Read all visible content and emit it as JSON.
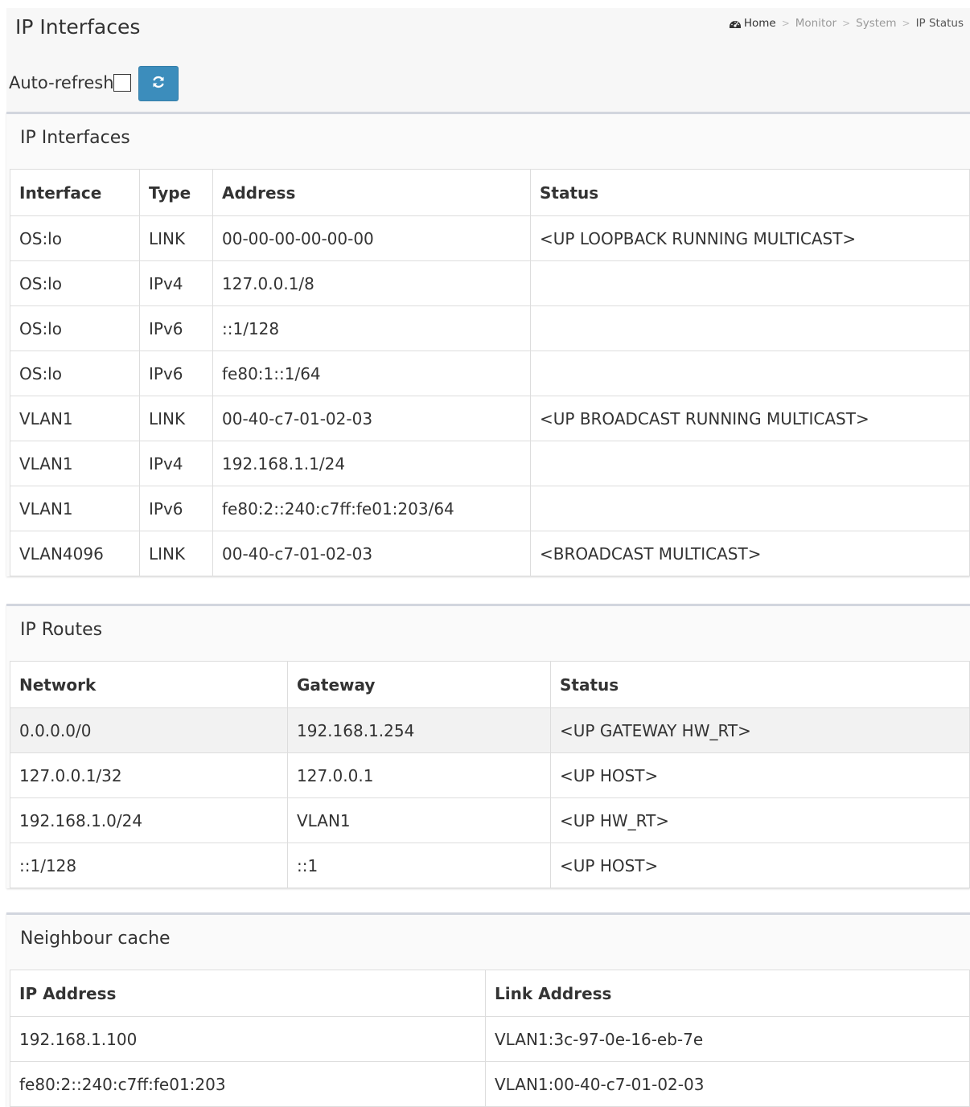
{
  "page": {
    "title": "IP Interfaces",
    "breadcrumb": [
      "Home",
      "Monitor",
      "System",
      "IP Status"
    ]
  },
  "toolbar": {
    "auto_refresh_label": "Auto-refresh",
    "auto_refresh_checked": false
  },
  "ip_interfaces": {
    "title": "IP Interfaces",
    "headers": [
      "Interface",
      "Type",
      "Address",
      "Status"
    ],
    "rows": [
      [
        "OS:lo",
        "LINK",
        "00-00-00-00-00-00",
        "<UP LOOPBACK RUNNING MULTICAST>"
      ],
      [
        "OS:lo",
        "IPv4",
        "127.0.0.1/8",
        ""
      ],
      [
        "OS:lo",
        "IPv6",
        "::1/128",
        ""
      ],
      [
        "OS:lo",
        "IPv6",
        "fe80:1::1/64",
        ""
      ],
      [
        "VLAN1",
        "LINK",
        "00-40-c7-01-02-03",
        "<UP BROADCAST RUNNING MULTICAST>"
      ],
      [
        "VLAN1",
        "IPv4",
        "192.168.1.1/24",
        ""
      ],
      [
        "VLAN1",
        "IPv6",
        "fe80:2::240:c7ff:fe01:203/64",
        ""
      ],
      [
        "VLAN4096",
        "LINK",
        "00-40-c7-01-02-03",
        "<BROADCAST MULTICAST>"
      ]
    ]
  },
  "ip_routes": {
    "title": "IP Routes",
    "headers": [
      "Network",
      "Gateway",
      "Status"
    ],
    "rows": [
      [
        "0.0.0.0/0",
        "192.168.1.254",
        "<UP GATEWAY HW_RT>"
      ],
      [
        "127.0.0.1/32",
        "127.0.0.1",
        "<UP HOST>"
      ],
      [
        "192.168.1.0/24",
        "VLAN1",
        "<UP HW_RT>"
      ],
      [
        "::1/128",
        "::1",
        "<UP HOST>"
      ]
    ]
  },
  "neighbour_cache": {
    "title": "Neighbour cache",
    "headers": [
      "IP Address",
      "Link Address"
    ],
    "rows": [
      [
        "192.168.1.100",
        "VLAN1:3c-97-0e-16-eb-7e"
      ],
      [
        "fe80:2::240:c7ff:fe01:203",
        "VLAN1:00-40-c7-01-02-03"
      ]
    ]
  },
  "colors": {
    "accent": "#3c8dbc",
    "box_border": "#d2d6de"
  },
  "icons": {
    "home": "dashboard-icon",
    "refresh": "refresh-icon"
  }
}
